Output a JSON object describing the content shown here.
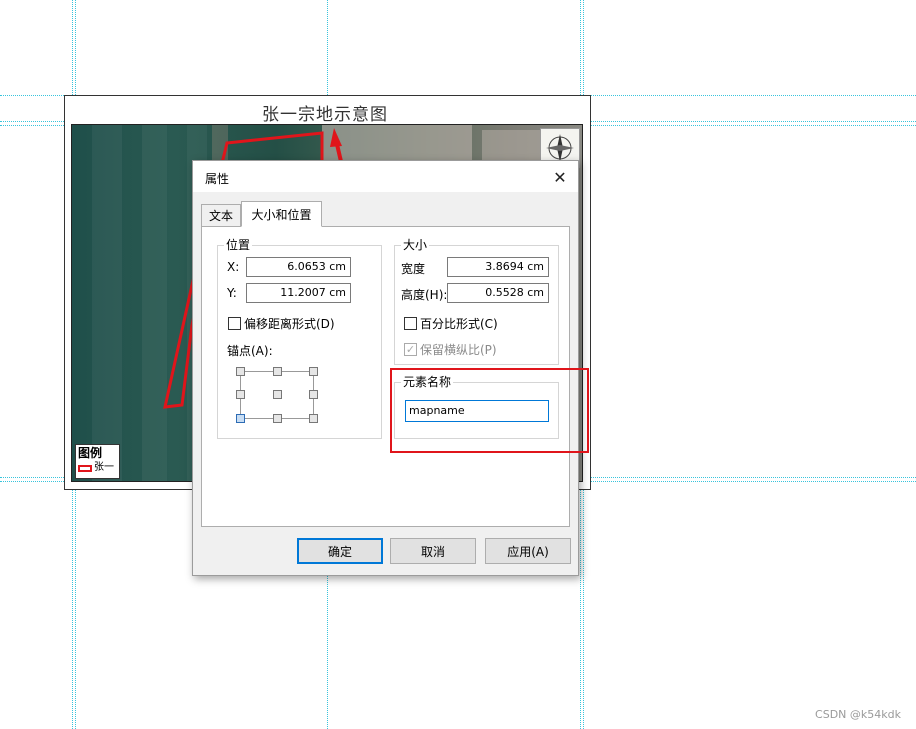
{
  "map": {
    "title": "张一宗地示意图",
    "legend_title": "图例",
    "legend_item": "张一",
    "parcel_color": "#e0151b",
    "compass_icon": "north-arrow-icon"
  },
  "dialog": {
    "title": "属性",
    "close_glyph": "✕",
    "tabs": [
      {
        "label": "文本",
        "active": false
      },
      {
        "label": "大小和位置",
        "active": true
      }
    ],
    "position": {
      "group_label": "位置",
      "x_label": "X:",
      "x_value": "6.0653 cm",
      "y_label": "Y:",
      "y_value": "11.2007 cm",
      "offset_checkbox_label": "偏移距离形式(D)",
      "offset_checked": false,
      "anchor_label": "锚点(A):",
      "anchor_selected": "bottom-left"
    },
    "size": {
      "group_label": "大小",
      "width_label": "宽度",
      "width_value": "3.8694 cm",
      "height_label": "高度(H):",
      "height_value": "0.5528 cm",
      "percent_checkbox_label": "百分比形式(C)",
      "percent_checked": false,
      "keep_ratio_label": "保留横纵比(P)",
      "keep_ratio_checked": true,
      "keep_ratio_disabled": true
    },
    "element_name": {
      "group_label": "元素名称",
      "value": "mapname"
    },
    "buttons": {
      "ok": "确定",
      "cancel": "取消",
      "apply": "应用(A)"
    }
  },
  "annotation": {
    "highlight_color": "#e0151b",
    "arrow_color": "#e0151b"
  },
  "watermark": "CSDN @k54kdk"
}
